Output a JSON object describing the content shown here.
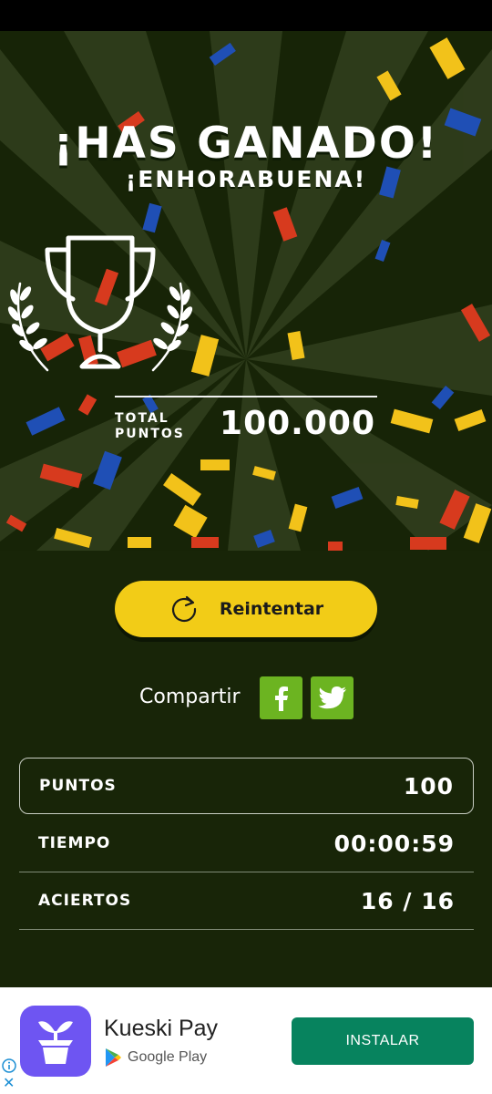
{
  "result": {
    "headline": "¡HAS GANADO!",
    "subheadline": "¡ENHORABUENA!",
    "total_label_line1": "TOTAL",
    "total_label_line2": "PUNTOS",
    "total_value": "100.000"
  },
  "actions": {
    "retry_label": "Reintentar",
    "share_label": "Compartir",
    "facebook_icon": "facebook-icon",
    "twitter_icon": "twitter-icon",
    "retry_icon": "refresh-icon"
  },
  "stats": [
    {
      "label": "PUNTOS",
      "value": "100"
    },
    {
      "label": "TIEMPO",
      "value": "00:00:59"
    },
    {
      "label": "ACIERTOS",
      "value": "16 / 16"
    }
  ],
  "ad": {
    "app_name": "Kueski Pay",
    "store": "Google Play",
    "install_label": "INSTALAR"
  },
  "colors": {
    "background": "#182508",
    "accent_yellow": "#f2cc17",
    "social_green": "#6cb421",
    "install_green": "#07835e",
    "confetti": [
      "#d73a1e",
      "#f2c21a",
      "#1f4fb5"
    ]
  }
}
